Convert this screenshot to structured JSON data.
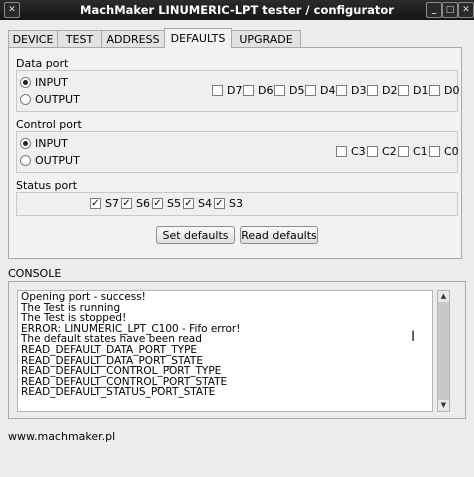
{
  "window": {
    "title": "MachMaker LINUMERIC-LPT tester / configurator",
    "menu_icon": "✕",
    "minimize_icon": "_",
    "maximize_icon": "□",
    "close_icon": "✕"
  },
  "tabs": [
    "DEVICE",
    "TEST",
    "ADDRESS",
    "DEFAULTS",
    "UPGRADE"
  ],
  "active_tab": "DEFAULTS",
  "data_port": {
    "label": "Data port",
    "input_label": "INPUT",
    "output_label": "OUTPUT",
    "selected": "INPUT",
    "bits": [
      {
        "label": "D7",
        "checked": false
      },
      {
        "label": "D6",
        "checked": false
      },
      {
        "label": "D5",
        "checked": false
      },
      {
        "label": "D4",
        "checked": false
      },
      {
        "label": "D3",
        "checked": false
      },
      {
        "label": "D2",
        "checked": false
      },
      {
        "label": "D1",
        "checked": false
      },
      {
        "label": "D0",
        "checked": false
      }
    ]
  },
  "control_port": {
    "label": "Control port",
    "input_label": "INPUT",
    "output_label": "OUTPUT",
    "selected": "INPUT",
    "bits": [
      {
        "label": "C3",
        "checked": false
      },
      {
        "label": "C2",
        "checked": false
      },
      {
        "label": "C1",
        "checked": false
      },
      {
        "label": "C0",
        "checked": false
      }
    ]
  },
  "status_port": {
    "label": "Status port",
    "bits": [
      {
        "label": "S7",
        "checked": true
      },
      {
        "label": "S6",
        "checked": true
      },
      {
        "label": "S5",
        "checked": true
      },
      {
        "label": "S4",
        "checked": true
      },
      {
        "label": "S3",
        "checked": true
      }
    ]
  },
  "buttons": {
    "set_defaults": "Set defaults",
    "read_defaults": "Read defaults"
  },
  "console": {
    "label": "CONSOLE",
    "lines": [
      "Opening port - success!",
      "The Test is running",
      "The Test is stopped!",
      "ERROR: LINUMERIC_LPT_C100 - Fifo error!",
      "The default states have been read",
      "READ_DEFAULT_DATA_PORT_TYPE",
      "READ_DEFAULT_DATA_PORT_STATE",
      "READ_DEFAULT_CONTROL_PORT_TYPE",
      "READ_DEFAULT_CONTROL_PORT_STATE",
      "READ_DEFAULT_STATUS_PORT_STATE"
    ]
  },
  "footer": {
    "url": "www.machmaker.pl"
  },
  "check_glyph": "✓"
}
